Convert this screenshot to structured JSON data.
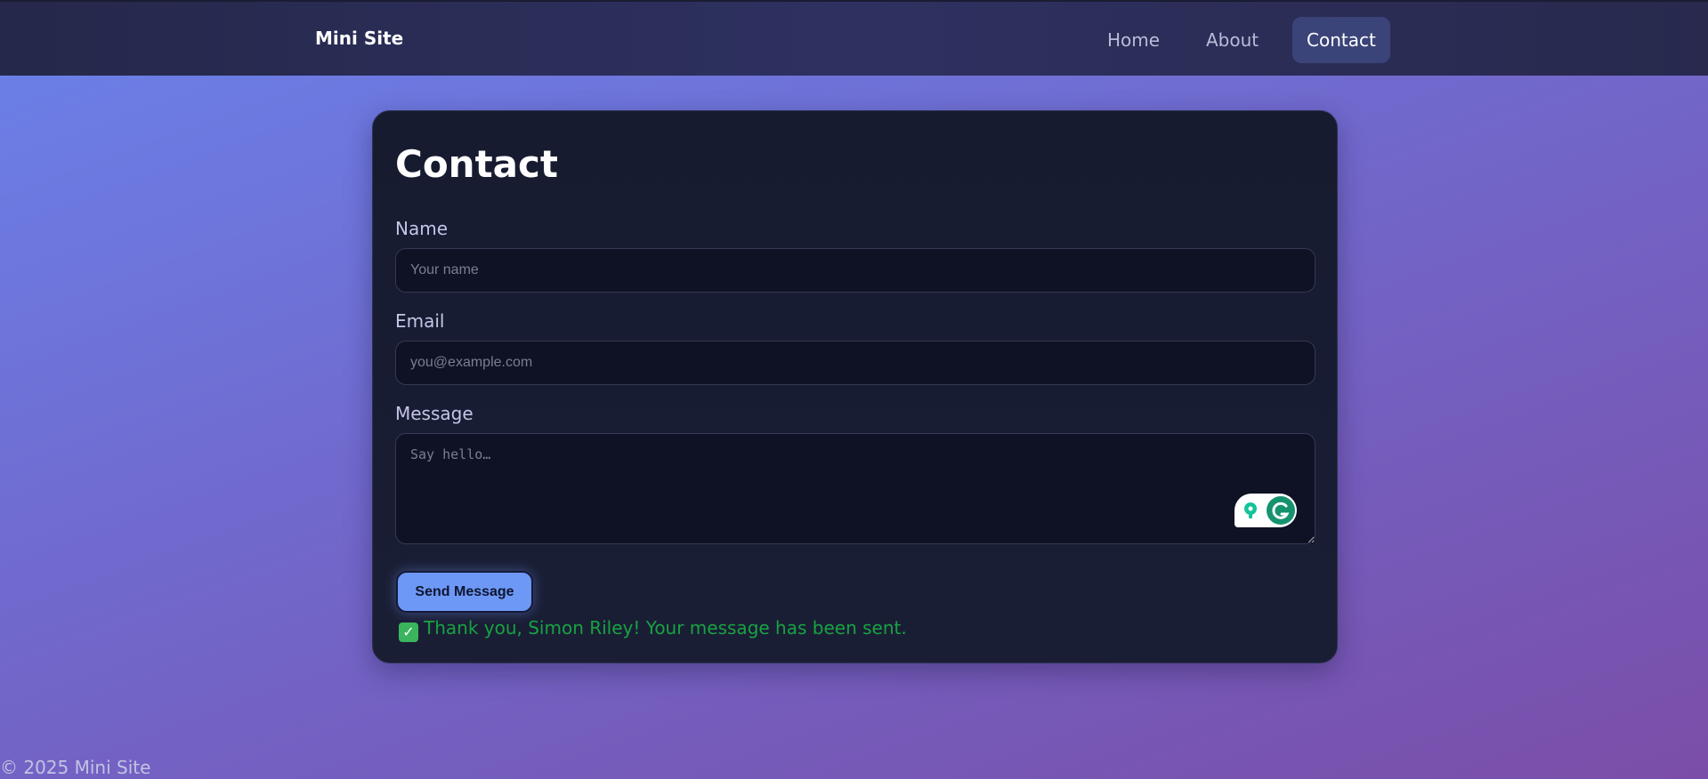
{
  "nav": {
    "brand": "Mini Site",
    "links": [
      "Home",
      "About",
      "Contact"
    ],
    "active": "Contact"
  },
  "contact": {
    "title": "Contact",
    "name_label": "Name",
    "name_placeholder": "Your name",
    "email_label": "Email",
    "email_placeholder": "you@example.com",
    "message_label": "Message",
    "message_placeholder": "Say hello…",
    "send_label": "Send Message",
    "success_message": "Thank you, Simon Riley! Your message has been sent."
  },
  "footer": {
    "text": "© 2025 Mini Site"
  },
  "colors": {
    "accent": "#6d98f5",
    "success": "#17a341",
    "card_bg": "#171b30",
    "nav_active_bg": "#3b4478"
  },
  "icons": {
    "success": "check-box-icon",
    "grammarly": "grammarly-widget-icon"
  }
}
